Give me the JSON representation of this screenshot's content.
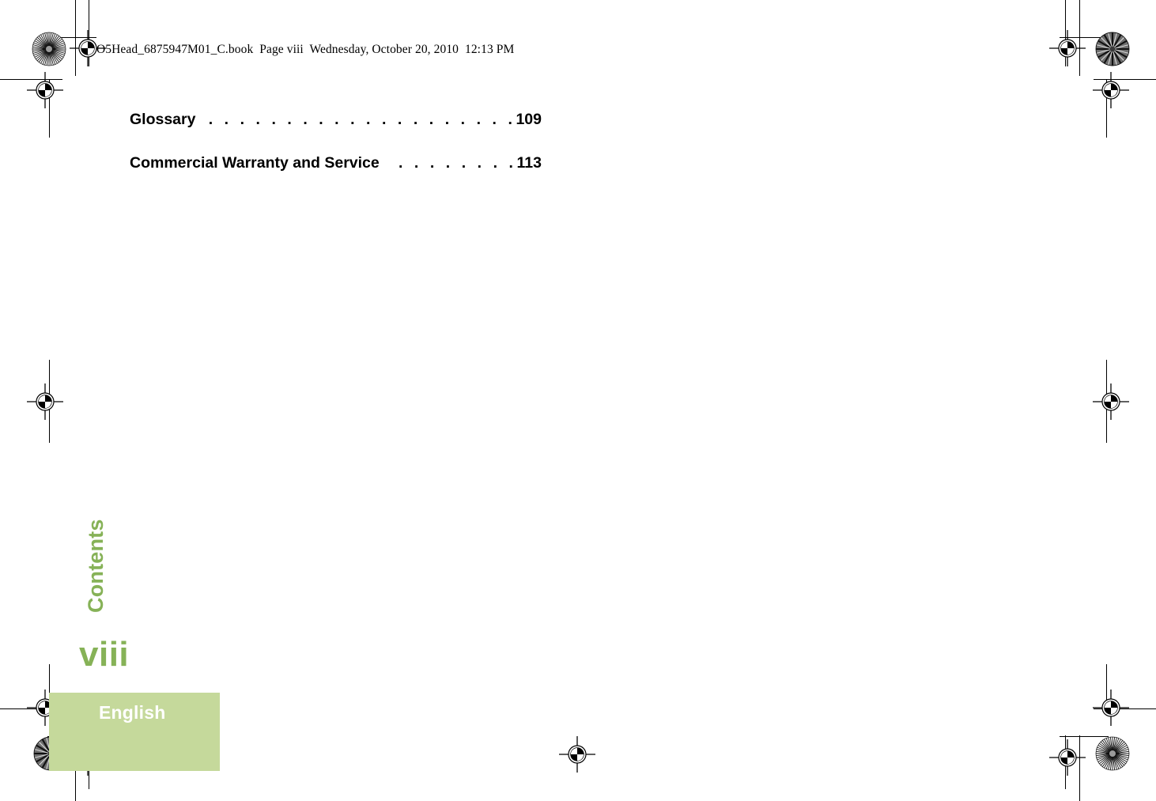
{
  "document": {
    "file_header": "O5Head_6875947M01_C.book  Page viii  Wednesday, October 20, 2010  12:13 PM",
    "page_folio": "viii",
    "section_label": "Contents",
    "language_label": "English"
  },
  "toc": {
    "leader": "...............................................",
    "entries": [
      {
        "title": "Glossary",
        "page": "109",
        "leader": ". . . . . . . . . . . . . . . . . . . . . . . . . . . ."
      },
      {
        "title": "Commercial Warranty and Service",
        "page": "113",
        "leader": ". . . . . . . ."
      }
    ]
  },
  "colors": {
    "accent_green": "#86b257",
    "block_green": "#c5d99b",
    "text_black": "#000000",
    "label_white": "#ffffff"
  },
  "print_marks": {
    "registration_icon": "registration-target-icon",
    "rosette_icon": "color-rosette-icon",
    "trim_line_icon": "trim-line"
  }
}
